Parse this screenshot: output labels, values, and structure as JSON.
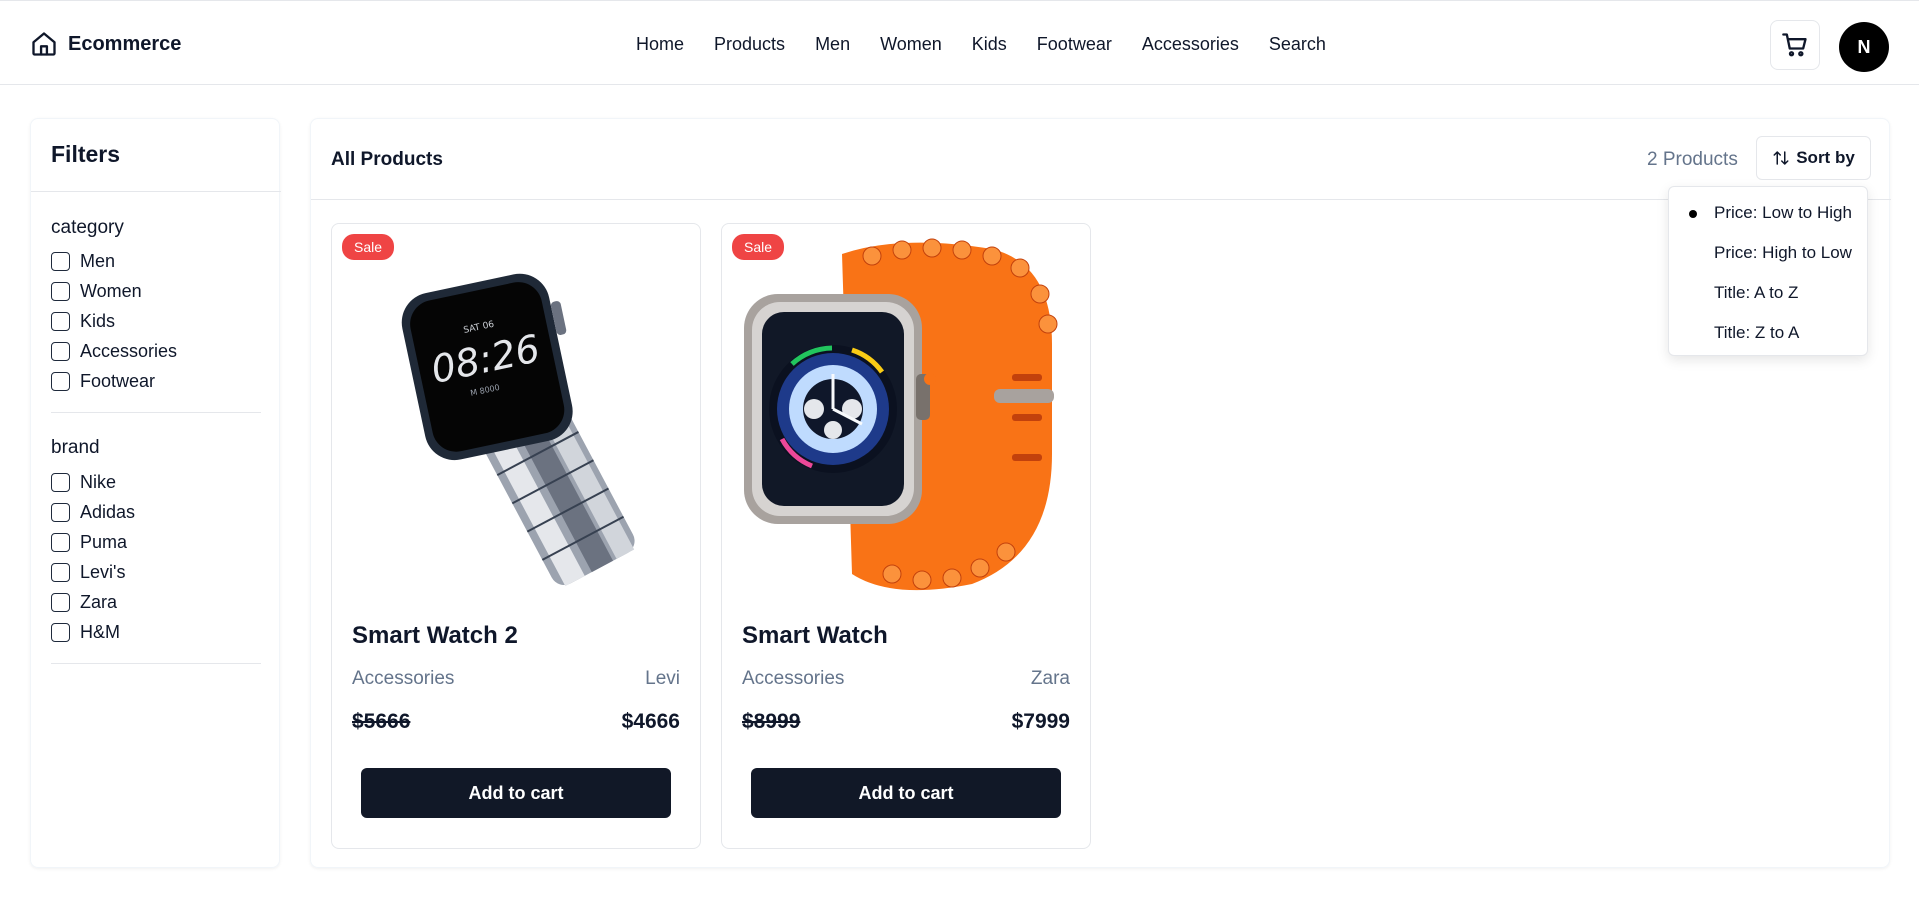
{
  "header": {
    "brand": "Ecommerce",
    "nav": [
      "Home",
      "Products",
      "Men",
      "Women",
      "Kids",
      "Footwear",
      "Accessories",
      "Search"
    ],
    "avatar_initial": "N"
  },
  "filters": {
    "title": "Filters",
    "category": {
      "title": "category",
      "options": [
        "Men",
        "Women",
        "Kids",
        "Accessories",
        "Footwear"
      ]
    },
    "brand": {
      "title": "brand",
      "options": [
        "Nike",
        "Adidas",
        "Puma",
        "Levi's",
        "Zara",
        "H&M"
      ]
    }
  },
  "main": {
    "title": "All Products",
    "count": "2 Products",
    "sort_label": "Sort by",
    "sort_options": [
      "Price: Low to High",
      "Price: High to Low",
      "Title: A to Z",
      "Title: Z to A"
    ],
    "sort_selected": "Price: Low to High"
  },
  "products": [
    {
      "badge": "Sale",
      "title": "Smart Watch 2",
      "category": "Accessories",
      "brand": "Levi",
      "old_price": "$5666",
      "price": "$4666",
      "button": "Add to cart"
    },
    {
      "badge": "Sale",
      "title": "Smart Watch",
      "category": "Accessories",
      "brand": "Zara",
      "old_price": "$8999",
      "price": "$7999",
      "button": "Add to cart"
    }
  ],
  "colors": {
    "sale": "#ef4444",
    "button": "#111827",
    "muted": "#64748b",
    "border": "#e5e7eb"
  },
  "icons": {
    "brand": "home-icon",
    "cart": "shopping-cart-icon",
    "sort": "arrow-up-down-icon",
    "selected": "dot-icon"
  }
}
